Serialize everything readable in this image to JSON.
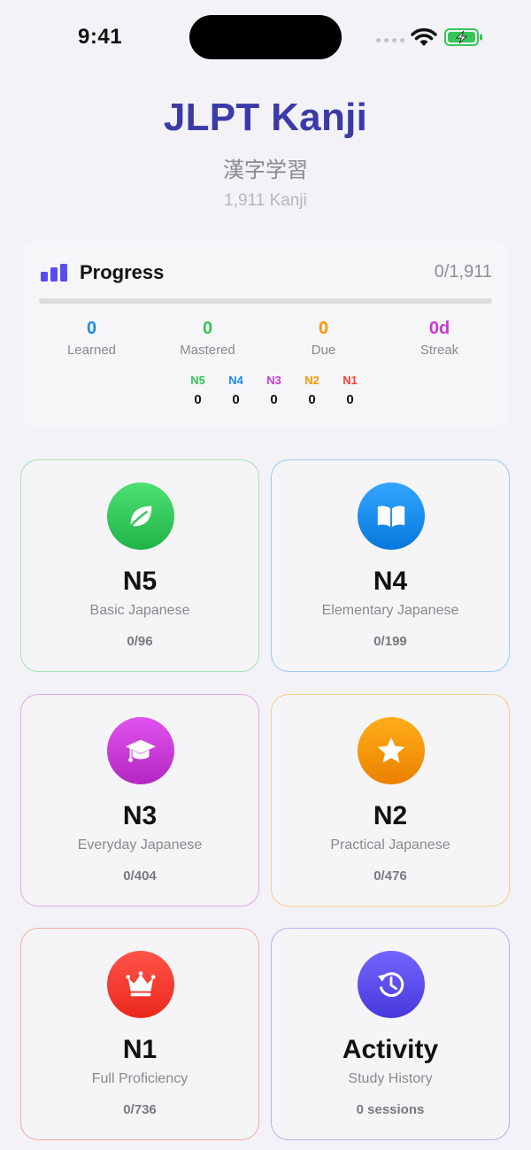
{
  "status_bar": {
    "time": "9:41"
  },
  "header": {
    "title": "JLPT Kanji",
    "subtitle": "漢字学習",
    "count": "1,911 Kanji"
  },
  "progress": {
    "title": "Progress",
    "total": "0/1,911",
    "fraction": 0,
    "stats": [
      {
        "value": "0",
        "label": "Learned",
        "color": "#1a8cf0"
      },
      {
        "value": "0",
        "label": "Mastered",
        "color": "#34c759"
      },
      {
        "value": "0",
        "label": "Due",
        "color": "#ff9500"
      },
      {
        "value": "0d",
        "label": "Streak",
        "color": "#c83ad6"
      }
    ],
    "levels": [
      {
        "name": "N5",
        "value": "0",
        "color": "#34c759"
      },
      {
        "name": "N4",
        "value": "0",
        "color": "#1a8cf0"
      },
      {
        "name": "N3",
        "value": "0",
        "color": "#c83ad6"
      },
      {
        "name": "N2",
        "value": "0",
        "color": "#ff9500"
      },
      {
        "name": "N1",
        "value": "0",
        "color": "#ff3b30"
      }
    ]
  },
  "cards": [
    {
      "title": "N5",
      "subtitle": "Basic Japanese",
      "progress": "0/96",
      "icon": "leaf-icon",
      "color": "#34c759"
    },
    {
      "title": "N4",
      "subtitle": "Elementary Japanese",
      "progress": "0/199",
      "icon": "book-icon",
      "color": "#1a8cf0"
    },
    {
      "title": "N3",
      "subtitle": "Everyday Japanese",
      "progress": "0/404",
      "icon": "graduation-cap-icon",
      "color": "#c83ad6"
    },
    {
      "title": "N2",
      "subtitle": "Practical Japanese",
      "progress": "0/476",
      "icon": "star-icon",
      "color": "#ff9500"
    },
    {
      "title": "N1",
      "subtitle": "Full Proficiency",
      "progress": "0/736",
      "icon": "crown-icon",
      "color": "#ff3b30"
    },
    {
      "title": "Activity",
      "subtitle": "Study History",
      "progress": "0 sessions",
      "icon": "history-clock-icon",
      "color": "#5b4cf0"
    }
  ]
}
